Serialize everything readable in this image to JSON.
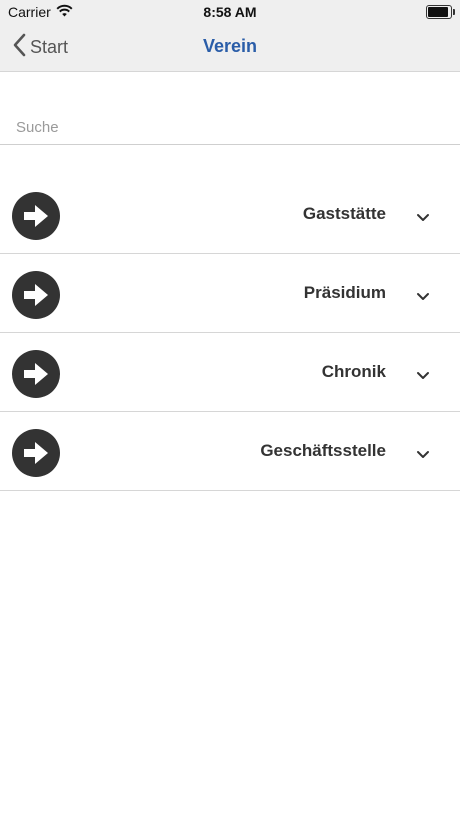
{
  "status_bar": {
    "carrier": "Carrier",
    "time": "8:58 AM"
  },
  "nav": {
    "back_label": "Start",
    "title": "Verein"
  },
  "search": {
    "placeholder": "Suche",
    "value": ""
  },
  "items": [
    {
      "label": "Gaststätte",
      "icon": "arrow-right-circle-icon"
    },
    {
      "label": "Präsidium",
      "icon": "arrow-right-circle-icon"
    },
    {
      "label": "Chronik",
      "icon": "arrow-right-circle-icon"
    },
    {
      "label": "Geschäftsstelle",
      "icon": "arrow-right-circle-icon"
    }
  ],
  "colors": {
    "title": "#2a5da8",
    "bar_bg": "#efefef",
    "icon_bg": "#333333"
  }
}
